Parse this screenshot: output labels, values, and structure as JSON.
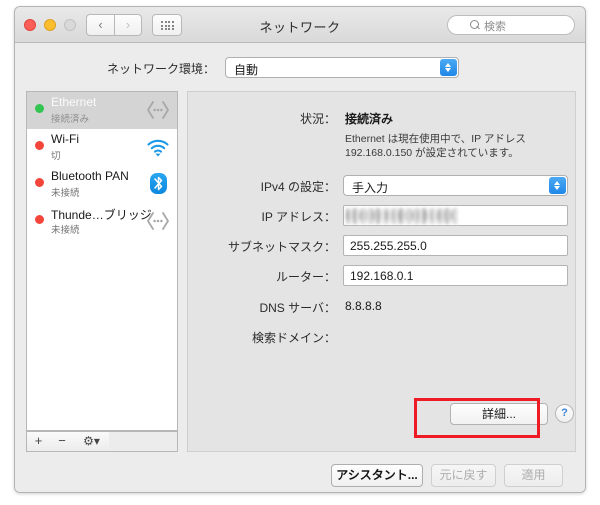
{
  "window": {
    "title": "ネットワーク",
    "traffic_lights": [
      "close",
      "minimize",
      "zoom"
    ],
    "nav": {
      "back": "‹",
      "forward": "›"
    },
    "grid_button": "show-all"
  },
  "search": {
    "placeholder": "検索",
    "value": ""
  },
  "location": {
    "label": "ネットワーク環境：",
    "selected": "自動"
  },
  "sidebar": {
    "services": [
      {
        "name": "Ethernet",
        "status": "接続済み",
        "dot": "green",
        "icon": "ethernet-icon",
        "selected": true
      },
      {
        "name": "Wi-Fi",
        "status": "切",
        "dot": "red",
        "icon": "wifi-icon",
        "selected": false
      },
      {
        "name": "Bluetooth PAN",
        "status": "未接続",
        "dot": "red",
        "icon": "bluetooth-icon",
        "selected": false
      },
      {
        "name": "Thunde…ブリッジ",
        "status": "未接続",
        "dot": "red",
        "icon": "ethernet-icon",
        "selected": false
      }
    ],
    "toolbar": {
      "add": "+",
      "remove": "−",
      "actions": "⚙"
    }
  },
  "panel": {
    "status_label": "状況：",
    "status_value": "接続済み",
    "status_description": "Ethernet は現在使用中で、IP アドレス 192.168.0.150 が設定されています。",
    "fields": [
      {
        "label": "IPv4 の設定：",
        "value": "手入力",
        "type": "popup"
      },
      {
        "label": "IP アドレス：",
        "value": "",
        "type": "text-redacted"
      },
      {
        "label": "サブネットマスク：",
        "value": "255.255.255.0",
        "type": "text"
      },
      {
        "label": "ルーター：",
        "value": "192.168.0.1",
        "type": "text"
      },
      {
        "label": "DNS サーバ：",
        "value": "8.8.8.8",
        "type": "static"
      },
      {
        "label": "検索ドメイン：",
        "value": "",
        "type": "static"
      }
    ],
    "advanced_button": "詳細...",
    "help_button": "?"
  },
  "footer": {
    "assistant": "アシスタント...",
    "revert": "元に戻す",
    "apply": "適用"
  },
  "annotation": {
    "color": "#ee1b24",
    "target": "詳細..."
  }
}
